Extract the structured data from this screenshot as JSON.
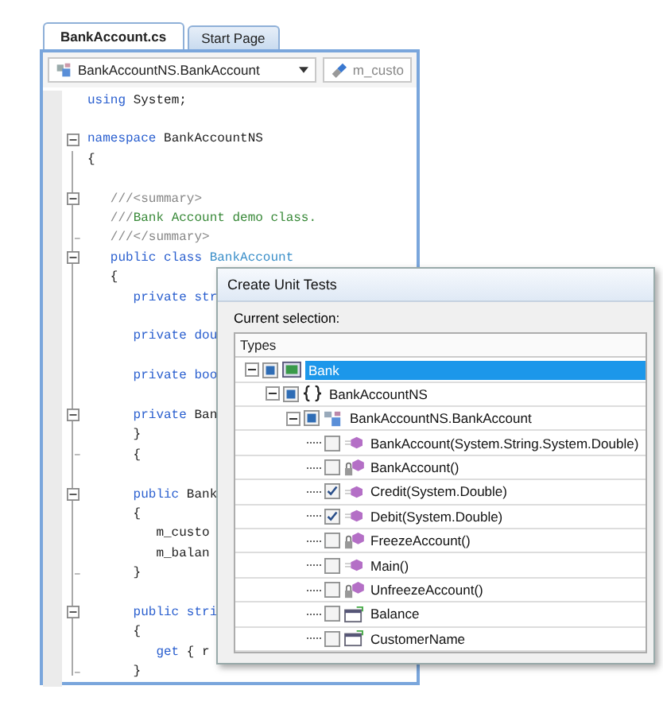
{
  "editor": {
    "tabs": [
      {
        "label": "BankAccount.cs",
        "selected": true
      },
      {
        "label": "Start Page",
        "selected": false
      }
    ],
    "type_dropdown": {
      "value": "BankAccountNS.BankAccount"
    },
    "member_dropdown": {
      "value": "m_custo"
    },
    "code_lines": [
      {
        "kind": "plain",
        "tokens": [
          {
            "text": "using",
            "kind": "keyword"
          },
          {
            "text": " System;",
            "kind": "plain"
          }
        ]
      },
      {
        "kind": "blank"
      },
      {
        "kind": "fold-start",
        "tokens": [
          {
            "text": "namespace",
            "kind": "keyword"
          },
          {
            "text": " BankAccountNS",
            "kind": "plain"
          }
        ]
      },
      {
        "kind": "plain",
        "tokens": [
          {
            "text": "{",
            "kind": "plain"
          }
        ]
      },
      {
        "kind": "blank"
      },
      {
        "kind": "fold-start",
        "tokens": [
          {
            "text": "   ///<summary>",
            "kind": "doc"
          }
        ]
      },
      {
        "kind": "plain",
        "tokens": [
          {
            "text": "   ///",
            "kind": "doc"
          },
          {
            "text": "Bank Account demo class.",
            "kind": "comment"
          }
        ]
      },
      {
        "kind": "fold-end",
        "tokens": [
          {
            "text": "   ///</summary>",
            "kind": "doc"
          }
        ]
      },
      {
        "kind": "fold-start",
        "tokens": [
          {
            "text": "   public class",
            "kind": "keyword"
          },
          {
            "text": " BankAccount",
            "kind": "type"
          }
        ]
      },
      {
        "kind": "plain",
        "tokens": [
          {
            "text": "   {",
            "kind": "plain"
          }
        ]
      },
      {
        "kind": "plain",
        "tokens": [
          {
            "text": "      private str",
            "kind": "keyword"
          }
        ]
      },
      {
        "kind": "blank"
      },
      {
        "kind": "plain",
        "tokens": [
          {
            "text": "      private dou",
            "kind": "keyword"
          }
        ]
      },
      {
        "kind": "blank"
      },
      {
        "kind": "plain",
        "tokens": [
          {
            "text": "      private boo",
            "kind": "keyword"
          }
        ]
      },
      {
        "kind": "blank"
      },
      {
        "kind": "fold-start",
        "tokens": [
          {
            "text": "      private",
            "kind": "keyword"
          },
          {
            "text": " Ban",
            "kind": "plain"
          }
        ]
      },
      {
        "kind": "plain",
        "tokens": [
          {
            "text": "      }",
            "kind": "plain"
          }
        ]
      },
      {
        "kind": "fold-end",
        "tokens": [
          {
            "text": "      {",
            "kind": "plain"
          }
        ]
      },
      {
        "kind": "blank"
      },
      {
        "kind": "fold-start",
        "tokens": [
          {
            "text": "      public",
            "kind": "keyword"
          },
          {
            "text": " Bank",
            "kind": "plain"
          }
        ]
      },
      {
        "kind": "plain",
        "tokens": [
          {
            "text": "      {",
            "kind": "plain"
          }
        ]
      },
      {
        "kind": "plain",
        "tokens": [
          {
            "text": "         m_custo",
            "kind": "plain"
          }
        ]
      },
      {
        "kind": "plain",
        "tokens": [
          {
            "text": "         m_balan",
            "kind": "plain"
          }
        ]
      },
      {
        "kind": "fold-end",
        "tokens": [
          {
            "text": "      }",
            "kind": "plain"
          }
        ]
      },
      {
        "kind": "blank"
      },
      {
        "kind": "fold-start",
        "tokens": [
          {
            "text": "      public stri",
            "kind": "keyword"
          }
        ]
      },
      {
        "kind": "plain",
        "tokens": [
          {
            "text": "      {",
            "kind": "plain"
          }
        ]
      },
      {
        "kind": "plain",
        "tokens": [
          {
            "text": "         get",
            "kind": "keyword"
          },
          {
            "text": " { r",
            "kind": "plain"
          }
        ]
      },
      {
        "kind": "fold-end",
        "tokens": [
          {
            "text": "      }",
            "kind": "plain"
          }
        ]
      }
    ]
  },
  "dialog": {
    "title": "Create Unit Tests",
    "selection_label": "Current selection:",
    "tree_header": "Types",
    "tree": [
      {
        "label": "Bank",
        "kind": "project",
        "checked": false,
        "partial": true,
        "expanded": true,
        "selected": true,
        "children": [
          {
            "label": "BankAccountNS",
            "kind": "namespace",
            "checked": false,
            "partial": true,
            "expanded": true,
            "selected": false,
            "children": [
              {
                "label": "BankAccountNS.BankAccount",
                "kind": "class",
                "checked": false,
                "partial": true,
                "expanded": true,
                "selected": false,
                "children": [
                  {
                    "label": "BankAccount(System.String.System.Double)",
                    "kind": "method",
                    "checked": false,
                    "partial": false,
                    "selected": false
                  },
                  {
                    "label": "BankAccount()",
                    "kind": "private-method",
                    "checked": false,
                    "partial": false,
                    "selected": false
                  },
                  {
                    "label": "Credit(System.Double)",
                    "kind": "method",
                    "checked": true,
                    "partial": false,
                    "selected": false
                  },
                  {
                    "label": "Debit(System.Double)",
                    "kind": "method",
                    "checked": true,
                    "partial": false,
                    "selected": false
                  },
                  {
                    "label": "FreezeAccount()",
                    "kind": "private-method",
                    "checked": false,
                    "partial": false,
                    "selected": false
                  },
                  {
                    "label": "Main()",
                    "kind": "method",
                    "checked": false,
                    "partial": false,
                    "selected": false
                  },
                  {
                    "label": "UnfreezeAccount()",
                    "kind": "private-method",
                    "checked": false,
                    "partial": false,
                    "selected": false
                  },
                  {
                    "label": "Balance",
                    "kind": "property",
                    "checked": false,
                    "partial": false,
                    "selected": false
                  },
                  {
                    "label": "CustomerName",
                    "kind": "property",
                    "checked": false,
                    "partial": false,
                    "selected": false
                  }
                ]
              }
            ]
          }
        ]
      }
    ]
  }
}
